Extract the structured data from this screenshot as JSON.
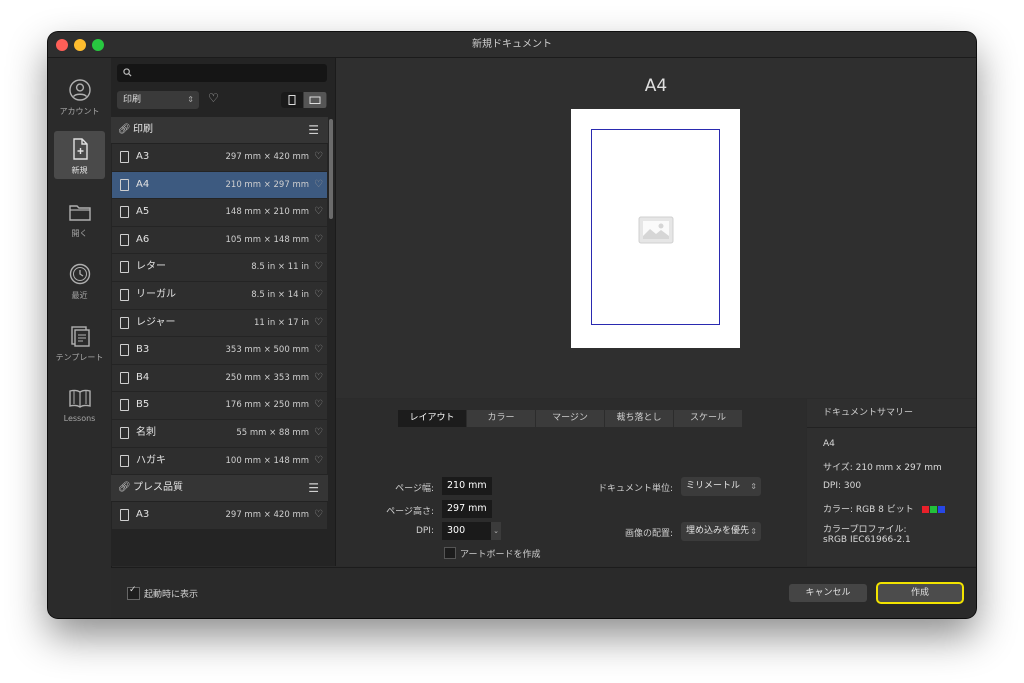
{
  "window": {
    "title": "新規ドキュメント"
  },
  "rail": {
    "items": [
      {
        "label": "アカウント",
        "icon": "account-icon"
      },
      {
        "label": "新規",
        "icon": "new-document-icon"
      },
      {
        "label": "開く",
        "icon": "folder-icon"
      },
      {
        "label": "最近",
        "icon": "recent-clock-icon"
      },
      {
        "label": "テンプレート",
        "icon": "template-icon"
      },
      {
        "label": "Lessons",
        "icon": "lessons-book-icon"
      }
    ]
  },
  "presets": {
    "search_placeholder": "",
    "category": "印刷",
    "groups": [
      {
        "title": "印刷",
        "items": [
          {
            "name": "A3",
            "size": "297 mm × 420 mm"
          },
          {
            "name": "A4",
            "size": "210 mm × 297 mm"
          },
          {
            "name": "A5",
            "size": "148 mm × 210 mm"
          },
          {
            "name": "A6",
            "size": "105 mm × 148 mm"
          },
          {
            "name": "レター",
            "size": "8.5 in × 11 in"
          },
          {
            "name": "リーガル",
            "size": "8.5 in × 14 in"
          },
          {
            "name": "レジャー",
            "size": "11 in × 17 in"
          },
          {
            "name": "B3",
            "size": "353 mm × 500 mm"
          },
          {
            "name": "B4",
            "size": "250 mm × 353 mm"
          },
          {
            "name": "B5",
            "size": "176 mm × 250 mm"
          },
          {
            "name": "名刺",
            "size": "55 mm × 88 mm"
          },
          {
            "name": "ハガキ",
            "size": "100 mm × 148 mm"
          }
        ]
      },
      {
        "title": "プレス品質",
        "items": [
          {
            "name": "A3",
            "size": "297 mm × 420 mm"
          }
        ]
      }
    ]
  },
  "preview": {
    "title": "A4"
  },
  "tabs": [
    "レイアウト",
    "カラー",
    "マージン",
    "裁ち落とし",
    "スケール"
  ],
  "layout": {
    "page_width_label": "ページ幅:",
    "page_width_value": "210 mm",
    "page_height_label": "ページ高さ:",
    "page_height_value": "297 mm",
    "dpi_label": "DPI:",
    "dpi_value": "300",
    "artboard_label": "アートボードを作成",
    "unit_label": "ドキュメント単位:",
    "unit_value": "ミリメートル",
    "placement_label": "画像の配置:",
    "placement_value": "埋め込みを優先"
  },
  "summary": {
    "header": "ドキュメントサマリー",
    "name": "A4",
    "size": "サイズ: 210 mm x 297 mm",
    "dpi": "DPI:  300",
    "color": "カラー: RGB 8 ビット",
    "profile_label": "カラープロファイル:",
    "profile_value": "sRGB IEC61966-2.1",
    "swatch_colors": [
      "#e8202a",
      "#22c03a",
      "#2747e6"
    ]
  },
  "footer": {
    "show_on_startup": "起動時に表示",
    "cancel": "キャンセル",
    "create": "作成"
  }
}
